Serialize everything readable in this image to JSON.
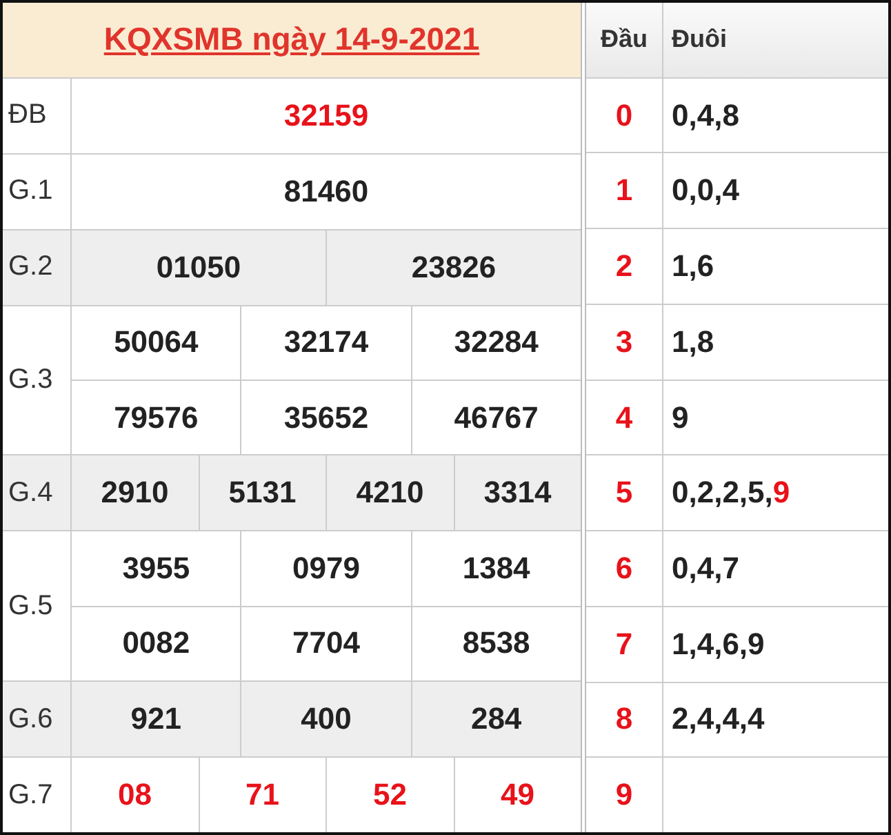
{
  "title": "KQXSMB ngày 14-9-2021",
  "prizes": [
    {
      "label": "ĐB",
      "shaded": false,
      "highlight": true,
      "lines": [
        [
          "32159"
        ]
      ]
    },
    {
      "label": "G.1",
      "shaded": false,
      "highlight": false,
      "lines": [
        [
          "81460"
        ]
      ]
    },
    {
      "label": "G.2",
      "shaded": true,
      "highlight": false,
      "lines": [
        [
          "01050",
          "23826"
        ]
      ]
    },
    {
      "label": "G.3",
      "shaded": false,
      "highlight": false,
      "lines": [
        [
          "50064",
          "32174",
          "32284"
        ],
        [
          "79576",
          "35652",
          "46767"
        ]
      ]
    },
    {
      "label": "G.4",
      "shaded": true,
      "highlight": false,
      "lines": [
        [
          "2910",
          "5131",
          "4210",
          "3314"
        ]
      ]
    },
    {
      "label": "G.5",
      "shaded": false,
      "highlight": false,
      "lines": [
        [
          "3955",
          "0979",
          "1384"
        ],
        [
          "0082",
          "7704",
          "8538"
        ]
      ]
    },
    {
      "label": "G.6",
      "shaded": true,
      "highlight": false,
      "lines": [
        [
          "921",
          "400",
          "284"
        ]
      ]
    },
    {
      "label": "G.7",
      "shaded": false,
      "highlight": true,
      "lines": [
        [
          "08",
          "71",
          "52",
          "49"
        ]
      ]
    }
  ],
  "loto": {
    "columns": [
      "Đầu",
      "Đuôi"
    ],
    "rows": [
      {
        "head": "0",
        "tails": [
          {
            "text": "0,4,8",
            "highlight": false
          }
        ]
      },
      {
        "head": "1",
        "tails": [
          {
            "text": "0,0,4",
            "highlight": false
          }
        ]
      },
      {
        "head": "2",
        "tails": [
          {
            "text": "1,6",
            "highlight": false
          }
        ]
      },
      {
        "head": "3",
        "tails": [
          {
            "text": "1,8",
            "highlight": false
          }
        ]
      },
      {
        "head": "4",
        "tails": [
          {
            "text": "9",
            "highlight": false
          }
        ]
      },
      {
        "head": "5",
        "tails": [
          {
            "text": "0,2,2,5,",
            "highlight": false
          },
          {
            "text": "9",
            "highlight": true
          }
        ]
      },
      {
        "head": "6",
        "tails": [
          {
            "text": "0,4,7",
            "highlight": false
          }
        ]
      },
      {
        "head": "7",
        "tails": [
          {
            "text": "1,4,6,9",
            "highlight": false
          }
        ]
      },
      {
        "head": "8",
        "tails": [
          {
            "text": "2,4,4,4",
            "highlight": false
          }
        ]
      },
      {
        "head": "9",
        "tails": []
      }
    ]
  }
}
